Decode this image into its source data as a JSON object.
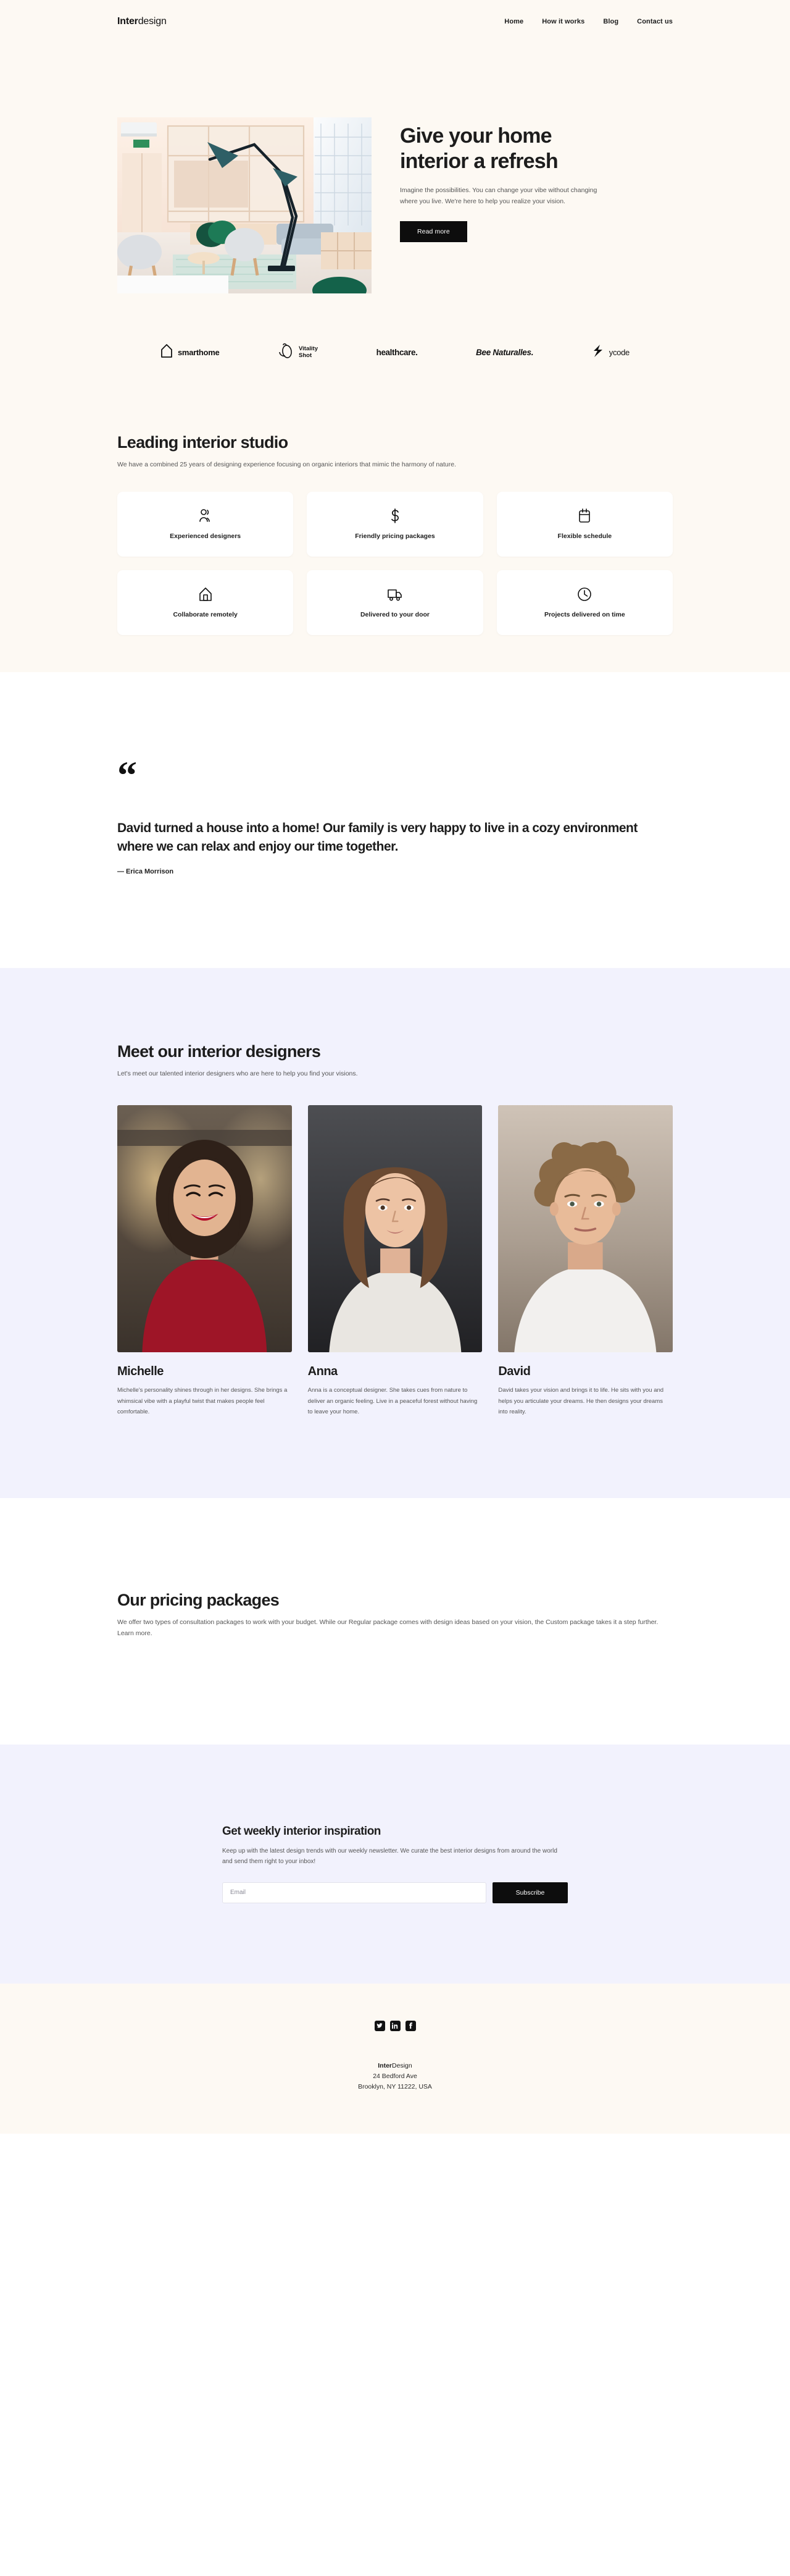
{
  "header": {
    "logo_bold": "Inter",
    "logo_light": "design",
    "nav": [
      {
        "label": "Home"
      },
      {
        "label": "How it works"
      },
      {
        "label": "Blog"
      },
      {
        "label": "Contact us"
      }
    ]
  },
  "hero": {
    "title_line1": "Give your home",
    "title_line2": "interior a refresh",
    "subtitle": "Imagine the possibilities. You can change your vibe without changing where you live. We're here to help you realize your vision.",
    "cta": "Read more",
    "image_alt": "modern-interior-lounge-photo"
  },
  "logos": [
    {
      "name": "smarthome",
      "icon": "house-outline-icon"
    },
    {
      "name_line1": "Vitality",
      "name_line2": "Shot",
      "icon": "fruit-slice-icon"
    },
    {
      "name": "healthcare.",
      "icon": "none"
    },
    {
      "name": "Bee Naturalles.",
      "icon": "none"
    },
    {
      "name": "ycode",
      "icon": "lightning-bolt-icon"
    }
  ],
  "studio": {
    "title": "Leading interior studio",
    "description": "We have a combined 25 years of designing experience focusing on organic interiors that mimic the harmony of nature.",
    "cards": [
      {
        "label": "Experienced designers",
        "icon": "people-icon"
      },
      {
        "label": "Friendly pricing packages",
        "icon": "dollar-icon"
      },
      {
        "label": "Flexible schedule",
        "icon": "calendar-icon"
      },
      {
        "label": "Collaborate remotely",
        "icon": "home-icon"
      },
      {
        "label": "Delivered to your door",
        "icon": "truck-icon"
      },
      {
        "label": "Projects delivered on time",
        "icon": "clock-icon"
      }
    ]
  },
  "testimonial": {
    "quote_mark": "“",
    "quote": "David turned a house into a home! Our family is very happy to live in a cozy environment where we can relax and enjoy our time together.",
    "author": "— Erica Morrison"
  },
  "designers": {
    "title": "Meet our interior designers",
    "description": "Let's meet our talented interior designers who are here to help you find your visions.",
    "people": [
      {
        "name": "Michelle",
        "bio": "Michelle's personality shines through in her designs. She brings a whimsical vibe with a playful twist that makes people feel comfortable.",
        "photo_alt": "portrait-michelle"
      },
      {
        "name": "Anna",
        "bio": "Anna is a conceptual designer. She takes cues from nature to deliver an organic feeling. Live in a peaceful forest without having to leave your home.",
        "photo_alt": "portrait-anna"
      },
      {
        "name": "David",
        "bio": "David takes your vision and brings it to life. He sits with you and helps you articulate your dreams. He then designs your dreams into reality.",
        "photo_alt": "portrait-david"
      }
    ]
  },
  "pricing": {
    "title": "Our pricing packages",
    "description": "We offer two types of consultation packages to work with your budget. While our Regular package comes with design ideas based on your vision, the Custom package takes it a step further. Learn more."
  },
  "newsletter": {
    "title": "Get weekly interior inspiration",
    "description": "Keep up with the latest design trends with our weekly newsletter. We curate the best interior designs from around the world and send them right to your inbox!",
    "email_placeholder": "Email",
    "email_value": "",
    "submit_label": "Subscribe"
  },
  "footer": {
    "socials": [
      {
        "name": "twitter-icon"
      },
      {
        "name": "linkedin-icon"
      },
      {
        "name": "facebook-icon"
      }
    ],
    "brand_bold": "Inter",
    "brand_light": "Design",
    "address_line1": "24 Bedford Ave",
    "address_line2": "Brooklyn, NY 11222, USA"
  },
  "colors": {
    "cream": "#fdf9f3",
    "lavender": "#f2f2fd",
    "dark": "#0d0d0d",
    "body_text": "#555555"
  }
}
